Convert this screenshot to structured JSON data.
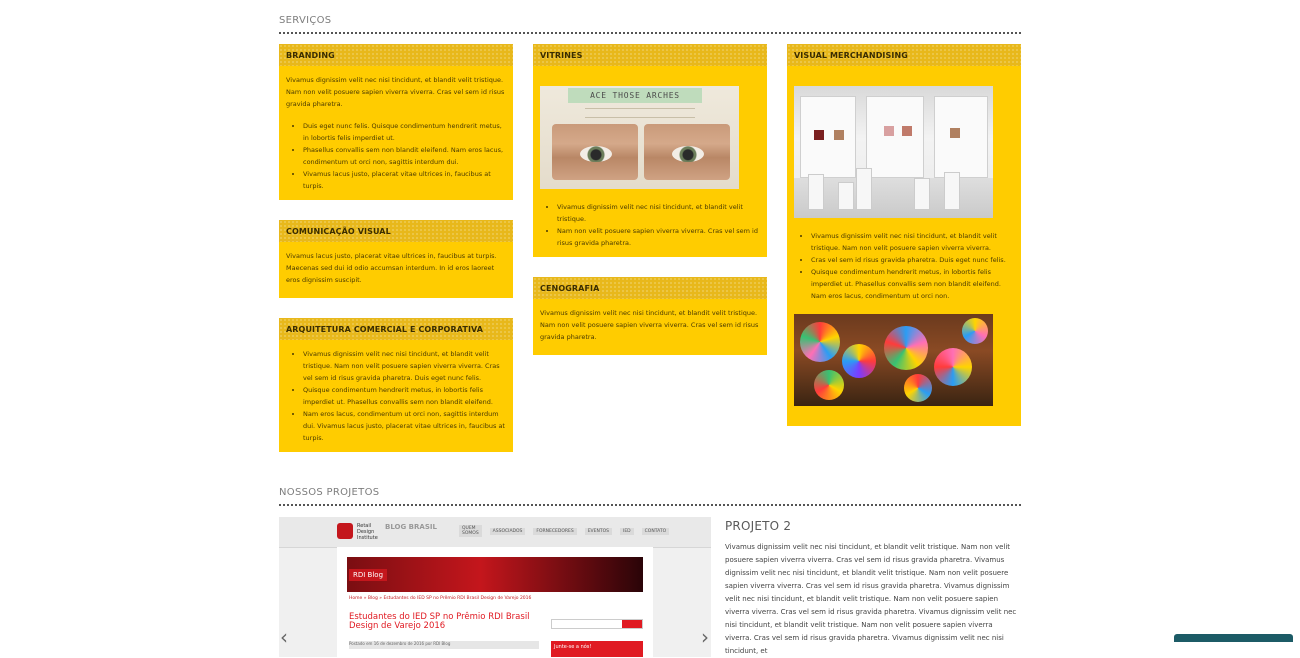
{
  "services": {
    "title": "SERVIÇOS",
    "branding": {
      "title": "BRANDING",
      "intro": "Vivamus dignissim velit nec nisi tincidunt, et blandit velit tristique. Nam non velit posuere sapien viverra viverra. Cras vel sem id risus gravida pharetra.",
      "items": [
        "Duis eget nunc felis. Quisque condimentum hendrerit metus, in lobortis felis imperdiet ut.",
        "Phasellus convallis sem non blandit eleifend. Nam eros lacus, condimentum ut orci non, sagittis interdum dui.",
        "Vivamus lacus justo, placerat vitae ultrices in, faucibus at turpis."
      ]
    },
    "comunicacao": {
      "title": "COMUNICAÇÃO VISUAL",
      "text": "Vivamus lacus justo, placerat vitae ultrices in, faucibus at turpis. Maecenas sed dui id odio accumsan interdum. In id eros laoreet eros dignissim suscipit."
    },
    "arquitetura": {
      "title": "ARQUITETURA COMERCIAL E CORPORATIVA",
      "items": [
        "Vivamus dignissim velit nec nisi tincidunt, et blandit velit tristique. Nam non velit posuere sapien viverra viverra. Cras vel sem id risus gravida pharetra. Duis eget nunc felis.",
        "Quisque condimentum hendrerit metus, in lobortis felis imperdiet ut. Phasellus convallis sem non blandit eleifend.",
        "Nam eros lacus, condimentum ut orci non, sagittis interdum dui. Vivamus lacus justo, placerat vitae ultrices in, faucibus at turpis."
      ]
    },
    "vitrines": {
      "title": "VITRINES",
      "image_caption": "ACE THOSE ARCHES",
      "items": [
        "Vivamus dignissim velit nec nisi tincidunt, et blandit velit tristique.",
        "Nam non velit posuere sapien viverra viverra. Cras vel sem id risus gravida pharetra."
      ]
    },
    "cenografia": {
      "title": "CENOGRAFIA",
      "text": "Vivamus dignissim velit nec nisi tincidunt, et blandit velit tristique. Nam non velit posuere sapien viverra viverra. Cras vel sem id risus gravida pharetra."
    },
    "visual_merch": {
      "title": "VISUAL MERCHANDISING",
      "items": [
        "Vivamus dignissim velit nec nisi tincidunt, et blandit velit tristique. Nam non velit posuere sapien viverra viverra.",
        "Cras vel sem id risus gravida pharetra. Duis eget nunc felis.",
        "Quisque condimentum hendrerit metus, in lobortis felis imperdiet ut. Phasellus convallis sem non blandit eleifend. Nam eros lacus, condimentum ut orci non."
      ]
    }
  },
  "projects": {
    "title": "NOSSOS PROJETOS",
    "project_title": "PROJETO 2",
    "description": "Vivamus dignissim velit nec nisi tincidunt, et blandit velit tristique. Nam non velit posuere sapien viverra viverra. Cras vel sem id risus gravida pharetra. Vivamus dignissim velit nec nisi tincidunt, et blandit velit tristique. Nam non velit posuere sapien viverra viverra. Cras vel sem id risus gravida pharetra. Vivamus dignissim velit nec nisi tincidunt, et blandit velit tristique. Nam non velit posuere sapien viverra viverra. Cras vel sem id risus gravida pharetra. Vivamus dignissim velit nec nisi tincidunt, et blandit velit tristique. Nam non velit posuere sapien viverra viverra. Cras vel sem id risus gravida pharetra. Vivamus dignissim velit nec nisi tincidunt, et",
    "slide": {
      "logo_text": "Retail Design Institute",
      "blog_label": "BLOG BRASIL",
      "nav": [
        "QUEM SOMOS",
        "ASSOCIADOS",
        "FORNECEDORES",
        "EVENTOS",
        "IED",
        "CONTATO"
      ],
      "banner_tag": "RDI Blog",
      "breadcrumb": "Home » Blog » Estudantes do IED SP no Prêmio RDI Brasil Design de Varejo 2016",
      "headline": "Estudantes do IED SP no Prêmio RDI Brasil Design de Varejo 2016",
      "date_line": "Postado em 16 de dezembro de 2016 por RDI Blog",
      "search_button": "Buscar",
      "join_label": "Junte-se a nós!"
    },
    "prev_arrow": "‹",
    "next_arrow": "›"
  },
  "colors": {
    "box": "#ffcc00",
    "box_head": "#e8b81b",
    "rdi_red": "#e01a22"
  }
}
